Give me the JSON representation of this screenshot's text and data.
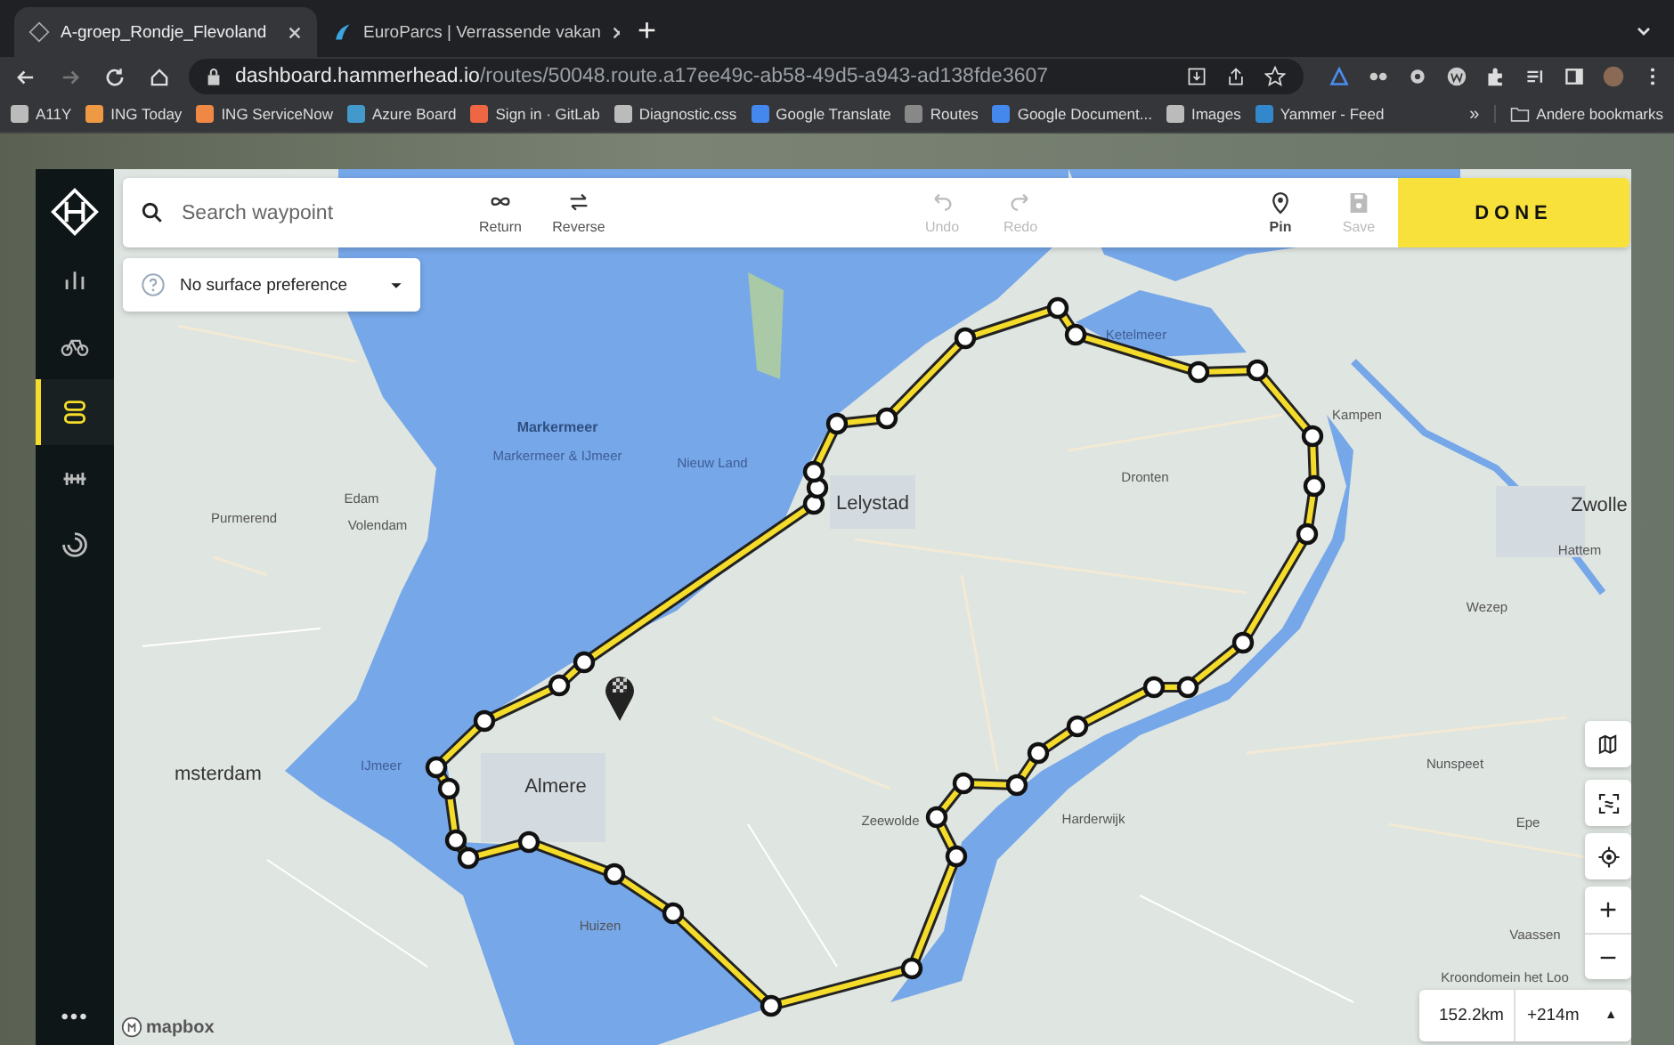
{
  "browser": {
    "tabs": [
      {
        "title": "A-groep_Rondje_Flevoland",
        "selected": true
      },
      {
        "title": "EuroParcs | Verrassende vakan",
        "selected": false
      }
    ],
    "new_tab": "+",
    "url": {
      "host": "dashboard.hammerhead.io",
      "path": "/routes/50048.route.a17ee49c-ab58-49d5-a943-ad138fde3607"
    },
    "bookmarks": [
      "A11Y",
      "ING Today",
      "ING ServiceNow",
      "Azure Board",
      "Sign in · GitLab",
      "Diagnostic.css",
      "Google Translate",
      "Routes",
      "Google Document...",
      "Images",
      "Yammer - Feed"
    ],
    "more_bookmarks": "»",
    "other_bookmarks": "Andere bookmarks"
  },
  "sidebar": {
    "items": [
      {
        "kind": "stats",
        "selected": false
      },
      {
        "kind": "bike",
        "selected": false
      },
      {
        "kind": "routes",
        "selected": true
      },
      {
        "kind": "workouts",
        "selected": false
      },
      {
        "kind": "progress",
        "selected": false
      }
    ],
    "more": "•••"
  },
  "toolbar": {
    "search": {
      "placeholder": "Search waypoint"
    },
    "actions": [
      {
        "kind": "return",
        "label": "Return",
        "disabled": false
      },
      {
        "kind": "reverse",
        "label": "Reverse",
        "disabled": false
      },
      {
        "kind": "undo",
        "label": "Undo",
        "disabled": true
      },
      {
        "kind": "redo",
        "label": "Redo",
        "disabled": true
      },
      {
        "kind": "pin",
        "label": "Pin",
        "disabled": false
      },
      {
        "kind": "save",
        "label": "Save",
        "disabled": true
      }
    ],
    "done": "DONE"
  },
  "surface": {
    "label": "No surface preference"
  },
  "map": {
    "labels": [
      {
        "text": "Markermeer",
        "kind": "water-bold"
      },
      {
        "text": "Markermeer & IJmeer",
        "kind": "water"
      },
      {
        "text": "Nieuw Land",
        "kind": "water"
      },
      {
        "text": "Edam",
        "kind": "town"
      },
      {
        "text": "Volendam",
        "kind": "town"
      },
      {
        "text": "Purmerend",
        "kind": "town"
      },
      {
        "text": "Lelystad",
        "kind": "city"
      },
      {
        "text": "Dronten",
        "kind": "town"
      },
      {
        "text": "Ketelmeer",
        "kind": "water"
      },
      {
        "text": "Kampen",
        "kind": "town"
      },
      {
        "text": "Zwolle",
        "kind": "city"
      },
      {
        "text": "Hattem",
        "kind": "town"
      },
      {
        "text": "Wezep",
        "kind": "town"
      },
      {
        "text": "IJmeer",
        "kind": "water"
      },
      {
        "text": "Almere",
        "kind": "city"
      },
      {
        "text": "Huizen",
        "kind": "town"
      },
      {
        "text": "Zeewolde",
        "kind": "town"
      },
      {
        "text": "Harderwijk",
        "kind": "town"
      },
      {
        "text": "Nunspeet",
        "kind": "town"
      },
      {
        "text": "Epe",
        "kind": "town"
      },
      {
        "text": "Vaassen",
        "kind": "town"
      },
      {
        "text": "Kroondomein het Loo",
        "kind": "town"
      },
      {
        "text": "msterdam",
        "kind": "city"
      }
    ],
    "attribution": "mapbox"
  },
  "stats": {
    "distance": "152.2km",
    "elevation": "+214m",
    "toggle": "▲"
  }
}
